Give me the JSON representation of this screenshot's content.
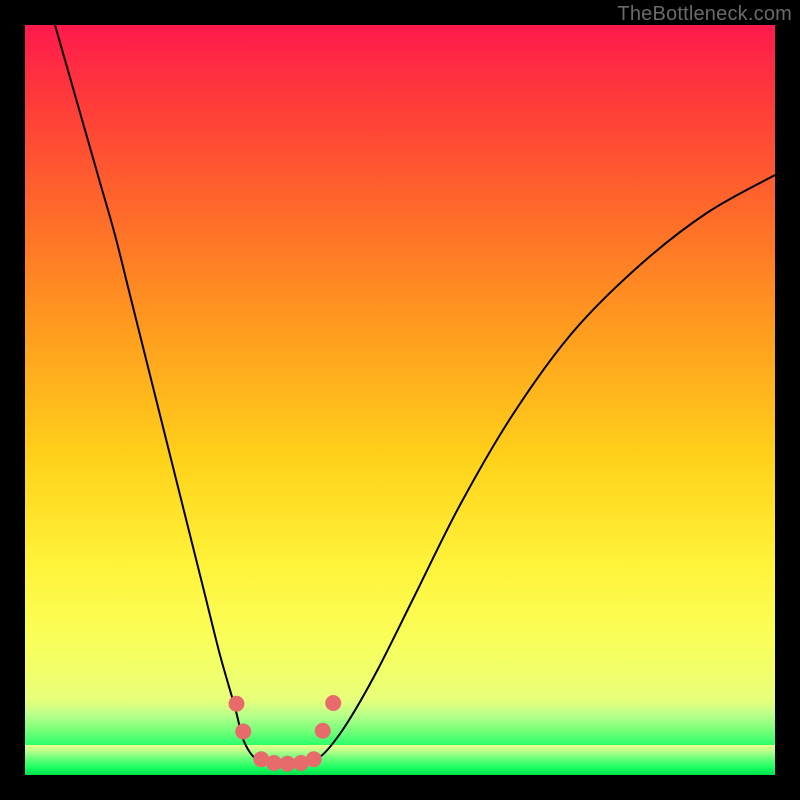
{
  "watermark": "TheBottleneck.com",
  "colors": {
    "frame": "#000000",
    "gradient_top": "#ff1a4d",
    "gradient_bottom": "#00e04a",
    "curve": "#000000",
    "dots": "#e86b6b"
  },
  "chart_data": {
    "type": "line",
    "title": "",
    "xlabel": "",
    "ylabel": "",
    "xlim": [
      0,
      100
    ],
    "ylim": [
      0,
      100
    ],
    "grid": false,
    "legend": false,
    "note": "Axis ticks and labels are not shown; x/y are normalized 0–100 approximations of pixel positions within the colored plot area (origin bottom-left). Two monotone branches meet in a flat valley at the bottom.",
    "series": [
      {
        "name": "left-branch",
        "x": [
          4,
          6,
          8,
          10,
          12,
          14,
          16,
          18,
          20,
          22,
          24,
          26,
          28,
          29,
          30,
          31,
          32
        ],
        "y": [
          100,
          93,
          86,
          79,
          72,
          64,
          56,
          48,
          40,
          32,
          24,
          16,
          9,
          5,
          3,
          2,
          1.7
        ]
      },
      {
        "name": "valley",
        "x": [
          32,
          33,
          34,
          35,
          36,
          37,
          38
        ],
        "y": [
          1.7,
          1.5,
          1.4,
          1.4,
          1.4,
          1.5,
          1.7
        ]
      },
      {
        "name": "right-branch",
        "x": [
          38,
          40,
          43,
          47,
          52,
          58,
          65,
          73,
          82,
          91,
          100
        ],
        "y": [
          1.7,
          3,
          7,
          14,
          24,
          36,
          48,
          59,
          68,
          75,
          80
        ]
      }
    ],
    "markers": [
      {
        "name": "left-upper-dot",
        "x": 28.2,
        "y": 9.5
      },
      {
        "name": "left-lower-dot",
        "x": 29.1,
        "y": 5.8
      },
      {
        "name": "right-lower-dot",
        "x": 39.7,
        "y": 5.9
      },
      {
        "name": "right-upper-dot",
        "x": 41.1,
        "y": 9.6
      },
      {
        "name": "valley-dot-1",
        "x": 31.5,
        "y": 2.1
      },
      {
        "name": "valley-dot-2",
        "x": 33.2,
        "y": 1.6
      },
      {
        "name": "valley-dot-3",
        "x": 35.0,
        "y": 1.5
      },
      {
        "name": "valley-dot-4",
        "x": 36.8,
        "y": 1.6
      },
      {
        "name": "valley-dot-5",
        "x": 38.5,
        "y": 2.1
      }
    ]
  }
}
